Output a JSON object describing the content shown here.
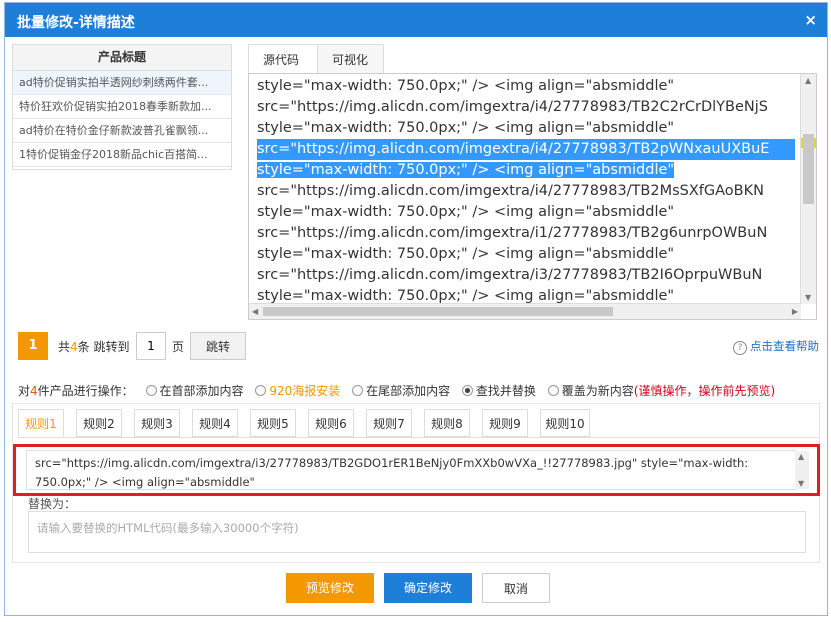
{
  "dialog": {
    "title": "批量修改-详情描述",
    "close": "×"
  },
  "product_list": {
    "header": "产品标题",
    "items": [
      "ad特价促销实拍半透网纱刺绣两件套...",
      "特价狂欢价促销实拍2018春季新款加...",
      "ad特价在特价金仔新款波普孔雀飘领...",
      "1特价促销金仔2018新品chic百搭简..."
    ]
  },
  "editor": {
    "tabs": [
      "源代码",
      "可视化"
    ],
    "lines": [
      "style=\"max-width: 750.0px;\" /> <img align=\"absmiddle\"",
      "src=\"https://img.alicdn.com/imgextra/i4/27778983/TB2C2rCrDlYBeNjS",
      "style=\"max-width: 750.0px;\" /> <img align=\"absmiddle\"",
      "src=\"https://img.alicdn.com/imgextra/i4/27778983/TB2pWNxauUXBuE",
      "style=\"max-width: 750.0px;\" /> <img align=\"absmiddle\"",
      "src=\"https://img.alicdn.com/imgextra/i4/27778983/TB2MsSXfGAoBKN",
      "style=\"max-width: 750.0px;\" /> <img align=\"absmiddle\"",
      "src=\"https://img.alicdn.com/imgextra/i1/27778983/TB2g6unrpOWBuN",
      "style=\"max-width: 750.0px;\" /> <img align=\"absmiddle\"",
      "src=\"https://img.alicdn.com/imgextra/i3/27778983/TB2I6OprpuWBuN",
      "style=\"max-width: 750.0px;\" /> <img align=\"absmiddle\""
    ]
  },
  "pager": {
    "current": "1",
    "total_prefix": "共",
    "total_count": "4",
    "total_suffix": "条 跳转到",
    "input_value": "1",
    "unit": "页",
    "jump_label": "跳转",
    "help_label": "点击查看帮助",
    "help_icon": "?"
  },
  "operations": {
    "prefix": "对",
    "count": "4",
    "suffix": "件产品进行操作：",
    "options": [
      "在首部添加内容",
      "920海报安装",
      "在尾部添加内容",
      "查找并替换",
      "覆盖为新内容"
    ],
    "warning": "(谨慎操作，操作前先预览)"
  },
  "rules": [
    "规则1",
    "规则2",
    "规则3",
    "规则4",
    "规则5",
    "规则6",
    "规则7",
    "规则8",
    "规则9",
    "规则10"
  ],
  "find": {
    "value_line1": "src=\"https://img.alicdn.com/imgextra/i3/27778983/TB2GDO1rER1BeNjy0FmXXb0wVXa_!!27778983.jpg\" style=\"max-width:",
    "value_line2": "750.0px;\" /> <img align=\"absmiddle\""
  },
  "replace": {
    "label": "替换为：",
    "placeholder": "请输入要替换的HTML代码(最多输入30000个字符)"
  },
  "buttons": {
    "preview": "预览修改",
    "confirm": "确定修改",
    "cancel": "取消"
  }
}
